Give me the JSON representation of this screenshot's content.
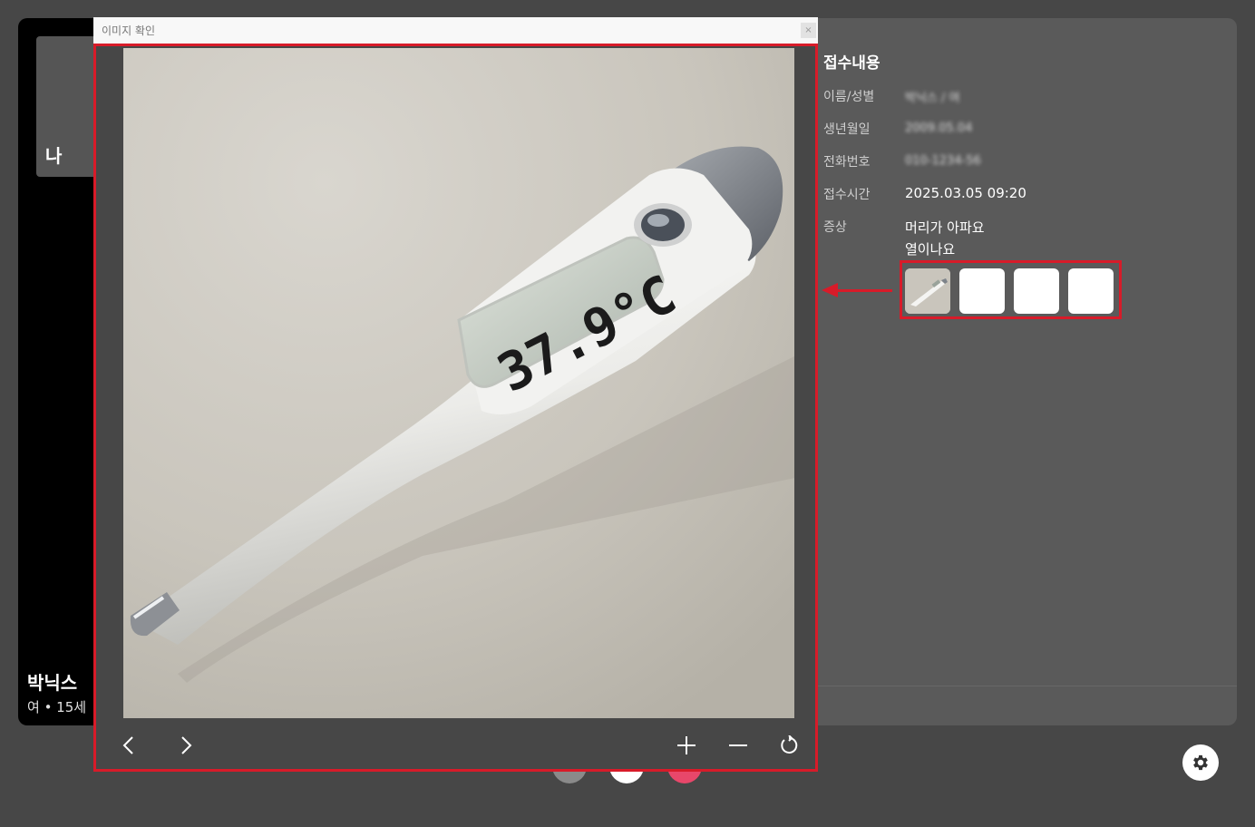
{
  "left": {
    "self_label": "나",
    "patient_name": "박닉스",
    "patient_meta": "여 • 15세"
  },
  "panel": {
    "title": "접수내용",
    "rows": [
      {
        "label": "이름/성별",
        "value": "박닉스 / 여"
      },
      {
        "label": "생년월일",
        "value": "2009.05.04"
      },
      {
        "label": "전화번호",
        "value": "010-1234-56"
      },
      {
        "label": "접수시간",
        "value": "2025.03.05 09:20"
      },
      {
        "label": "증상",
        "value": "머리가 아파요",
        "value2": "열이나요"
      }
    ]
  },
  "dialog": {
    "title": "이미지 확인",
    "close": "×",
    "thermometer_reading": "37.9°C"
  },
  "colors": {
    "highlight": "#d81b29",
    "end_call": "#e8476a"
  }
}
